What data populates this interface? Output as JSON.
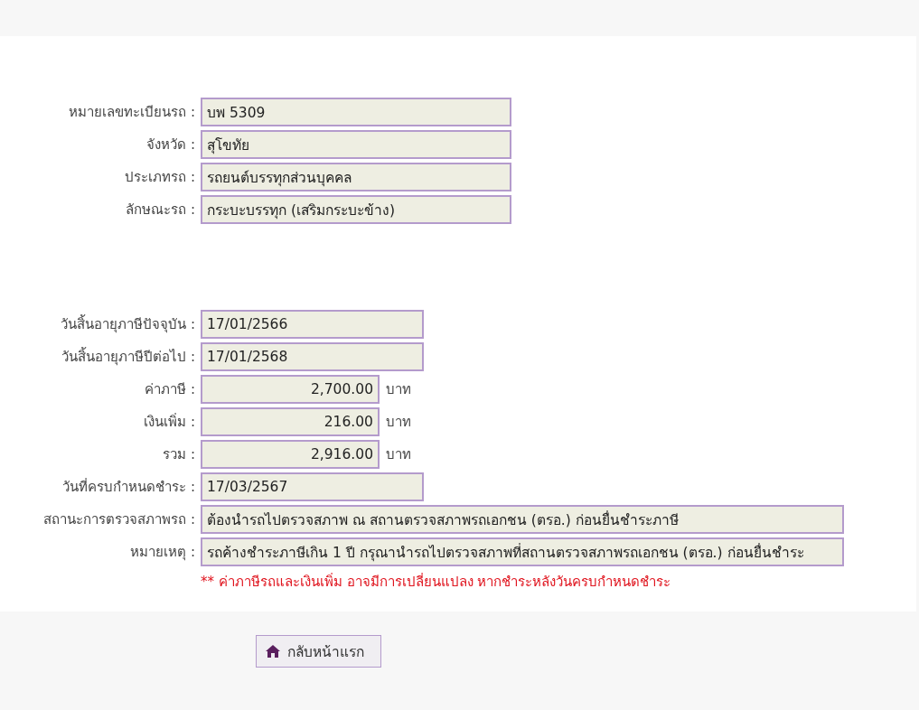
{
  "vehicle": [
    {
      "label": "หมายเลขทะเบียนรถ :",
      "value": "บพ 5309",
      "kind": "text"
    },
    {
      "label": "จังหวัด :",
      "value": "สุโขทัย",
      "kind": "text"
    },
    {
      "label": "ประเภทรถ :",
      "value": "รถยนต์บรรทุกส่วนบุคคล",
      "kind": "text"
    },
    {
      "label": "ลักษณะรถ :",
      "value": "กระบะบรรทุก (เสริมกระบะข้าง)",
      "kind": "text"
    }
  ],
  "tax": [
    {
      "label": "วันสิ้นอายุภาษีปัจจุบัน :",
      "value": "17/01/2566",
      "kind": "date"
    },
    {
      "label": "วันสิ้นอายุภาษีปีต่อไป :",
      "value": "17/01/2568",
      "kind": "date"
    },
    {
      "label": "ค่าภาษี :",
      "value": "2,700.00",
      "kind": "amount",
      "unit": "บาท"
    },
    {
      "label": "เงินเพิ่ม :",
      "value": "216.00",
      "kind": "amount",
      "unit": "บาท"
    },
    {
      "label": "รวม :",
      "value": "2,916.00",
      "kind": "amount",
      "unit": "บาท"
    },
    {
      "label": "วันที่ครบกำหนดชำระ :",
      "value": "17/03/2567",
      "kind": "date"
    },
    {
      "label": "สถานะการตรวจสภาพรถ :",
      "value": "ต้องนำรถไปตรวจสภาพ ณ สถานตรวจสภาพรถเอกชน (ตรอ.) ก่อนยื่นชำระภาษี",
      "kind": "long"
    },
    {
      "label": "หมายเหตุ :",
      "value": "รถค้างชำระภาษีเกิน 1 ปี กรุณานำรถไปตรวจสภาพที่สถานตรวจสภาพรถเอกชน (ตรอ.) ก่อนยื่นชำระ",
      "kind": "long"
    }
  ],
  "warning": "** ค่าภาษีรถและเงินเพิ่ม อาจมีการเปลี่ยนแปลง หากชำระหลังวันครบกำหนดชำระ",
  "home_button": "กลับหน้าแรก"
}
